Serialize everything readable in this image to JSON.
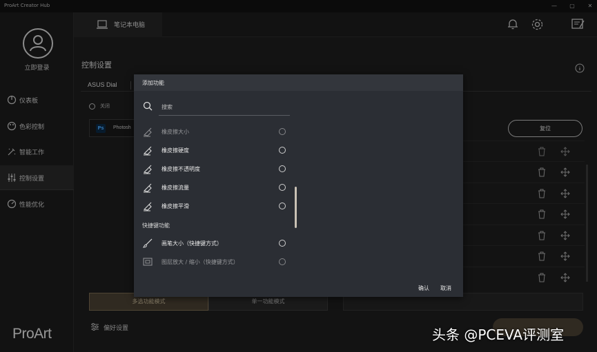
{
  "window": {
    "title": "ProArt Creator Hub"
  },
  "sidebar": {
    "login_label": "立即登录",
    "items": [
      {
        "label": "仪表板",
        "icon": "dashboard-icon"
      },
      {
        "label": "色彩控制",
        "icon": "palette-icon"
      },
      {
        "label": "智能工作",
        "icon": "smart-work-icon"
      },
      {
        "label": "控制设置",
        "icon": "sliders-icon",
        "active": true
      },
      {
        "label": "性能优化",
        "icon": "performance-icon"
      }
    ],
    "logo": "ProArt"
  },
  "header": {
    "device_label": "笔记本电脑"
  },
  "main": {
    "title": "控制设置",
    "tab_label": "ASUS Dial",
    "off_label": "关闭",
    "app_name": "Photosh",
    "app_badge": "Ps",
    "reset_label": "复位",
    "mode_multi": "多选功能模式",
    "mode_single": "单一功能模式",
    "pref_label": "偏好设置"
  },
  "modal": {
    "title": "添加功能",
    "search_placeholder": "搜索",
    "items": [
      {
        "label": "橡皮擦大小",
        "faded": true
      },
      {
        "label": "橡皮擦硬度"
      },
      {
        "label": "橡皮擦不透明度"
      },
      {
        "label": "橡皮擦流量"
      },
      {
        "label": "橡皮擦平滑"
      }
    ],
    "section_label": "快捷键功能",
    "shortcut_items": [
      {
        "label": "画笔大小（快捷键方式）"
      },
      {
        "label": "图层放大 / 缩小（快捷键方式）",
        "faded": true
      }
    ],
    "confirm_label": "确认",
    "cancel_label": "取消"
  },
  "watermark": "头条 @PCEVA评测室",
  "colors": {
    "accent": "#4a4133",
    "modal_bg": "#2b2e34",
    "scroll_thumb": "#c9c1b4"
  }
}
